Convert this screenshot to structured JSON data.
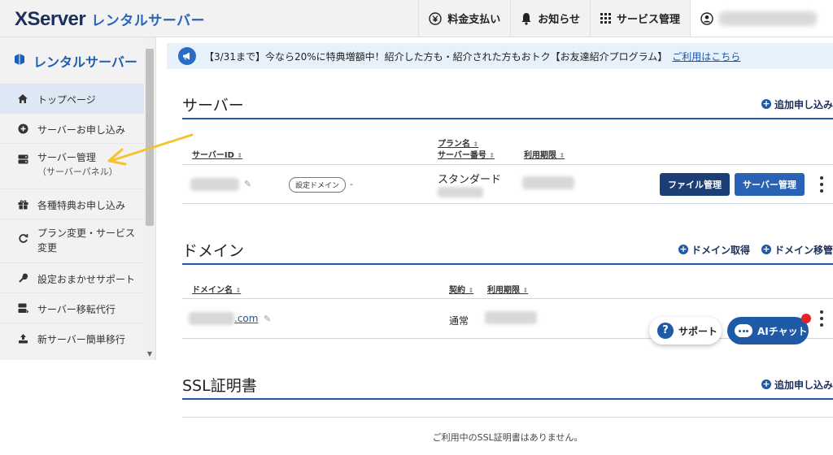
{
  "header": {
    "logo_main": "XServer",
    "logo_sub": "レンタルサーバー",
    "nav": {
      "payment": "料金支払い",
      "notice": "お知らせ",
      "services": "サービス管理"
    }
  },
  "sidebar": {
    "title": "レンタルサーバー",
    "items": [
      {
        "label": "トップページ",
        "icon": "home-icon"
      },
      {
        "label": "サーバーお申し込み",
        "icon": "plus-circle-icon"
      },
      {
        "label": "サーバー管理",
        "sub": "（サーバーパネル）",
        "icon": "server-icon"
      },
      {
        "label": "各種特典お申し込み",
        "icon": "gift-icon"
      },
      {
        "label": "プラン変更・サービス",
        "label2": "変更",
        "icon": "refresh-icon"
      },
      {
        "label": "設定おまかせサポート",
        "icon": "wrench-icon"
      },
      {
        "label": "サーバー移転代行",
        "icon": "server-move-icon"
      },
      {
        "label": "新サーバー簡単移行",
        "icon": "upload-icon"
      }
    ]
  },
  "announcement": {
    "text": "【3/31まで】今なら20%に特典増額中！紹介した方も・紹介された方もおトク【お友達紹介プログラム】",
    "link": "ご利用はこちら"
  },
  "server_section": {
    "title": "サーバー",
    "add_label": "追加申し込み",
    "headers": {
      "server_id": "サーバーID",
      "plan": "プラン名",
      "server_no": "サーバー番号",
      "expiry": "利用期限"
    },
    "row": {
      "domain_tag": "設定ドメイン",
      "dash": "-",
      "plan": "スタンダード",
      "file_btn": "ファイル管理",
      "server_btn": "サーバー管理"
    }
  },
  "domain_section": {
    "title": "ドメイン",
    "acquire_label": "ドメイン取得",
    "transfer_label": "ドメイン移管",
    "headers": {
      "domain": "ドメイン名",
      "contract": "契約",
      "expiry": "利用期限"
    },
    "row": {
      "domain_suffix": ".com",
      "contract": "通常"
    }
  },
  "ssl_section": {
    "title": "SSL証明書",
    "add_label": "追加申し込み",
    "empty": "ご利用中のSSL証明書はありません。"
  },
  "floating": {
    "support": "サポート",
    "ai_chat": "AIチャット"
  },
  "colors": {
    "brand_navy": "#1b2f5a",
    "brand_blue": "#1e5aa6",
    "button_dark": "#1b3f74",
    "announce_bg": "#e7f1fb",
    "arrow_yellow": "#f5c230",
    "badge_red": "#e32424"
  }
}
